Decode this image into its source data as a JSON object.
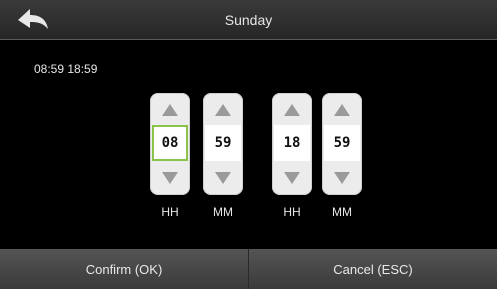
{
  "header": {
    "title": "Sunday",
    "back_icon": "back-arrow-icon"
  },
  "time_range_text": "08:59  18:59",
  "spinners": [
    {
      "value": "08",
      "unit": "HH",
      "selected": true
    },
    {
      "value": "59",
      "unit": "MM",
      "selected": false
    },
    {
      "value": "18",
      "unit": "HH",
      "selected": false
    },
    {
      "value": "59",
      "unit": "MM",
      "selected": false
    }
  ],
  "footer": {
    "confirm_label": "Confirm (OK)",
    "cancel_label": "Cancel (ESC)"
  },
  "colors": {
    "selected_border": "#8bc34a",
    "header_bg": "#2e2e2e",
    "footer_bg": "#4a4a4a",
    "spinner_bg": "#ececec"
  }
}
